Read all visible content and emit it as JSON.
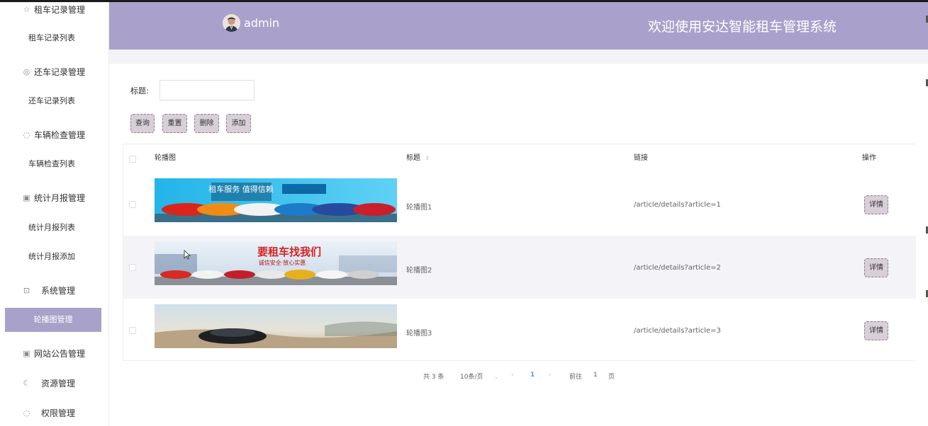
{
  "sidebar": {
    "items": [
      {
        "label": "租车记录管理",
        "icon": "star-icon"
      },
      {
        "label": "租车记录列表"
      },
      {
        "label": "还车记录管理",
        "icon": "compass-icon"
      },
      {
        "label": "还车记录列表"
      },
      {
        "label": "车辆检查管理",
        "icon": "flame-icon"
      },
      {
        "label": "车辆检查列表"
      },
      {
        "label": "统计月报管理",
        "icon": "calendar-icon"
      },
      {
        "label": "统计月报列表"
      },
      {
        "label": "统计月报添加"
      },
      {
        "label": "系统管理",
        "icon": "box-icon"
      },
      {
        "label": "轮播图管理"
      },
      {
        "label": "网站公告管理",
        "icon": "calendar-icon"
      },
      {
        "label": "资源管理",
        "icon": "moon-icon"
      },
      {
        "label": "权限管理",
        "icon": "flame-icon"
      }
    ]
  },
  "header": {
    "username": "admin",
    "title": "欢迎使用安达智能租车管理系统"
  },
  "search": {
    "label": "标题:",
    "value": "",
    "placeholder": ""
  },
  "toolbar": {
    "query": "查询",
    "reset": "重置",
    "delete": "删除",
    "add": "添加"
  },
  "table": {
    "headers": {
      "image": "轮播图",
      "title": "标题",
      "link": "链接",
      "action": "操作"
    },
    "rows": [
      {
        "title": "轮播图1",
        "link": "/article/details?article=1",
        "action": "详情",
        "banner_text": "租车服务 值得信赖"
      },
      {
        "title": "轮播图2",
        "link": "/article/details?article=2",
        "action": "详情",
        "banner_text": "要租车找我们",
        "banner_sub": "诚信安全·放心实惠"
      },
      {
        "title": "轮播图3",
        "link": "/article/details?article=3",
        "action": "详情",
        "banner_text": ""
      }
    ]
  },
  "pagination": {
    "total": "共 3 条",
    "page_size": "10条/页",
    "current": "1",
    "goto_label": "前往",
    "goto_value": "1",
    "page_unit": "页"
  },
  "colors": {
    "header": "#a9a1cb",
    "active_menu": "#a8a1ca",
    "button_bg": "#d8cfd8",
    "button_border": "#8e7d8e"
  }
}
